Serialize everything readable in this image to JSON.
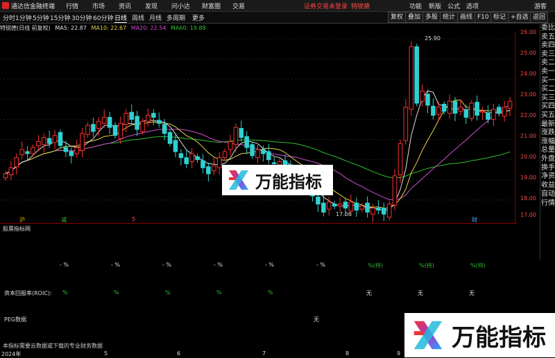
{
  "app": {
    "title": "通达信金融终端",
    "menu": [
      "行情",
      "市场",
      "资讯",
      "发现",
      "问小达",
      "财富圈",
      "交易"
    ],
    "login_status": "证券交易未登录",
    "trade_label": "特锐德",
    "right_menu": [
      "功能",
      "新版",
      "公式",
      "选项"
    ],
    "guest": "游客"
  },
  "toolbar": {
    "periods": [
      "分时",
      "1分钟",
      "5分钟",
      "15分钟",
      "30分钟",
      "60分钟",
      "日线",
      "周线",
      "月线",
      "多周期",
      "更多"
    ],
    "active_period": "日线",
    "right_buttons": [
      "复权",
      "叠加",
      "多股",
      "统计",
      "画线",
      "F10",
      "标记",
      "+自选",
      "返回"
    ]
  },
  "chart_header": {
    "stock": "特锐德(日线 前复权)",
    "ma5": "MA5: 22.87",
    "ma10": "MA10: 22.67",
    "ma20": "MA20: 22.54",
    "ma60": "MA60: 19.88",
    "colors": {
      "ma5": "#e0e0e0",
      "ma10": "#e8d84a",
      "ma20": "#d050d0",
      "ma60": "#30c030"
    }
  },
  "price_axis": [
    "26.00",
    "25.00",
    "24.00",
    "23.00",
    "22.00",
    "21.00",
    "20.00",
    "19.00",
    "18.00",
    "17.00"
  ],
  "annotations": {
    "high": "25.90",
    "low": "17.06"
  },
  "sidebar": [
    "委比",
    "卖五",
    "卖四",
    "卖三",
    "卖二",
    "卖一",
    "买一",
    "买二",
    "买三",
    "买四",
    "买五",
    "最新",
    "涨跌",
    "涨幅",
    "总量",
    "外盘",
    "换手",
    "净资",
    "收益",
    "自动",
    "行情"
  ],
  "indicator": {
    "title": "股票指标网",
    "percent_row": [
      "- %",
      "- %",
      "- %",
      "- %",
      "- %",
      "- %",
      "%(持)",
      "%(持)",
      "%(持)"
    ],
    "roic_label": "资本回报率(ROIC):",
    "roic_row": [
      "%",
      "%",
      "%",
      "%",
      "%",
      "无",
      "无",
      "无"
    ],
    "peg_label": "PEG数据",
    "peg_value": "无",
    "note": "本指标需要云数据或下载的专业财务数据"
  },
  "date_axis": [
    "2024年",
    "5",
    "6",
    "7",
    "8",
    "9",
    "10"
  ],
  "markers": [
    "沪",
    "减",
    "5",
    "财"
  ],
  "watermark": {
    "text": "万能指标"
  },
  "chart_data": {
    "type": "candlestick",
    "ylim": [
      17,
      26.2
    ],
    "close": [
      19.3,
      19.6,
      20.1,
      20.5,
      20.3,
      20.6,
      20.9,
      21.1,
      20.8,
      21.2,
      20.7,
      20.4,
      20.2,
      20.6,
      21.3,
      21.7,
      21.4,
      21.9,
      22.1,
      21.6,
      21.2,
      21.8,
      22.3,
      22.0,
      21.5,
      21.9,
      22.2,
      22.1,
      21.8,
      21.3,
      20.8,
      20.4,
      20.1,
      19.8,
      20.3,
      20.0,
      19.6,
      19.3,
      19.7,
      20.1,
      20.4,
      20.9,
      21.6,
      21.1,
      20.6,
      20.2,
      20.5,
      20.3,
      20.0,
      19.8,
      19.9,
      19.6,
      19.4,
      19.1,
      18.8,
      18.5,
      18.2,
      17.8,
      17.4,
      17.9,
      17.7,
      17.8,
      17.6,
      17.9,
      17.5,
      17.7,
      17.4,
      17.6,
      17.5,
      17.3,
      17.8,
      19.2,
      20.8,
      22.6,
      25.6,
      22.8,
      23.4,
      22.7,
      22.2,
      22.6,
      22.4,
      22.9,
      22.3,
      22.6,
      22.1,
      22.8,
      22.2,
      22.4,
      22.0,
      22.5,
      22.3,
      22.6,
      22.9
    ]
  }
}
